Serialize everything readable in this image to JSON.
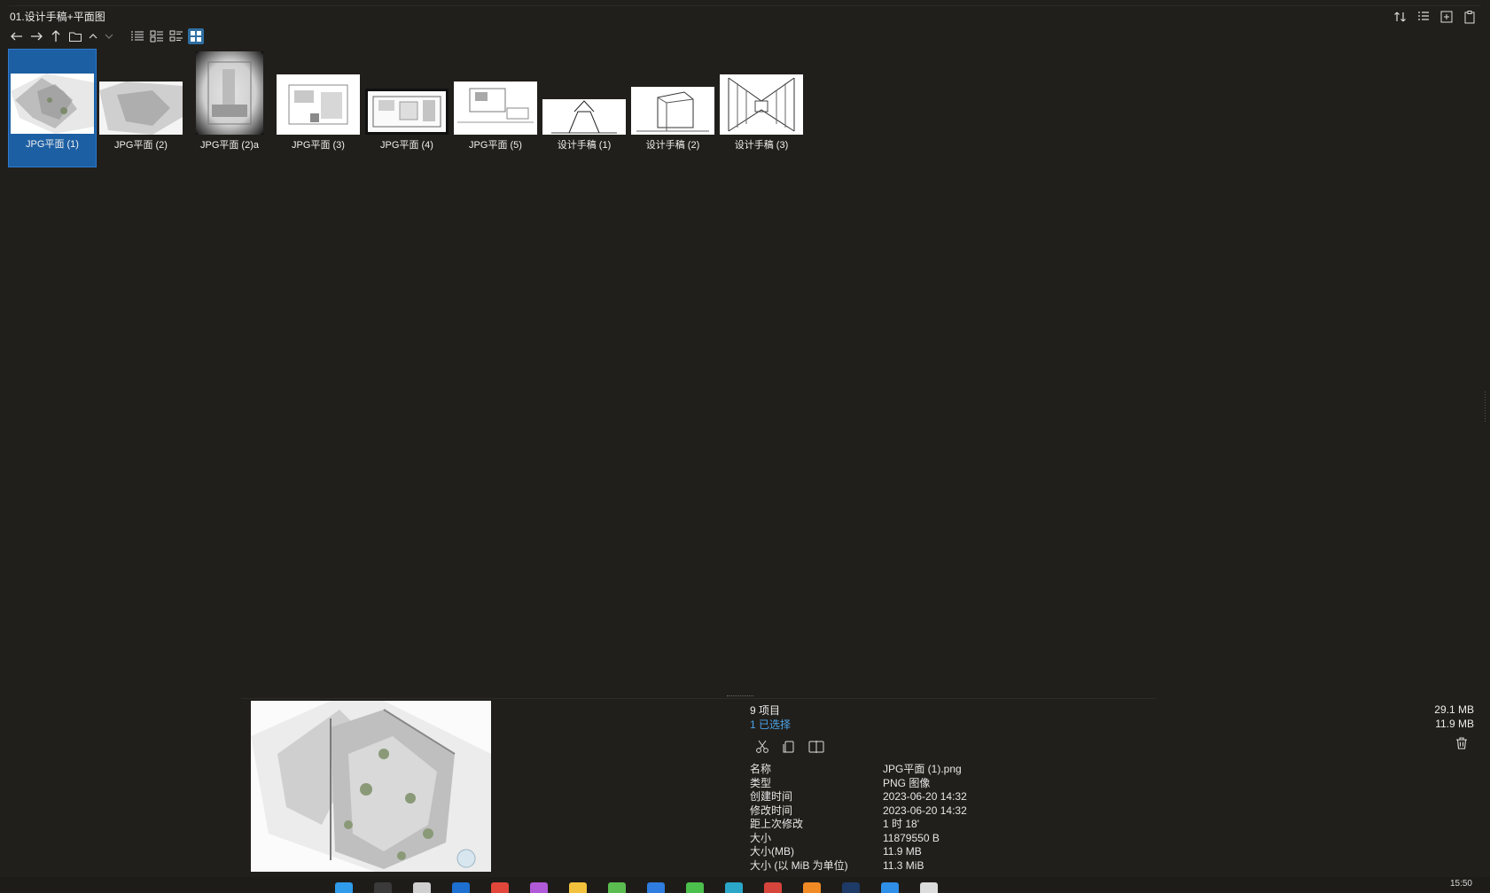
{
  "window": {
    "title": "01.设计手稿+平面图"
  },
  "toolbar": {
    "buttons": [
      {
        "name": "back-button",
        "icon": "arrow-left-icon"
      },
      {
        "name": "forward-button",
        "icon": "arrow-right-icon"
      },
      {
        "name": "up-button",
        "icon": "arrow-up-icon"
      },
      {
        "name": "folder-button",
        "icon": "folder-icon"
      },
      {
        "name": "chevron-up-button",
        "icon": "chevron-up-icon"
      },
      {
        "name": "chevron-down-button",
        "icon": "chevron-down-icon"
      },
      {
        "name": "view-list-button",
        "icon": "list-view-icon"
      },
      {
        "name": "view-details-button",
        "icon": "details-view-icon"
      },
      {
        "name": "view-tiles-button",
        "icon": "tiles-view-icon"
      },
      {
        "name": "view-thumbnails-button",
        "icon": "thumbnails-view-icon",
        "active": true
      }
    ],
    "active_color": "#2f6fa3"
  },
  "top_right": [
    "sort-icon",
    "properties-icon",
    "new-icon",
    "paste-icon"
  ],
  "files": [
    {
      "label": "JPG平面 (1)",
      "selected": true
    },
    {
      "label": "JPG平面 (2)"
    },
    {
      "label": "JPG平面 (2)a"
    },
    {
      "label": "JPG平面 (3)"
    },
    {
      "label": "JPG平面 (4)"
    },
    {
      "label": "JPG平面 (5)"
    },
    {
      "label": "设计手稿 (1)"
    },
    {
      "label": "设计手稿 (2)"
    },
    {
      "label": "设计手稿 (3)"
    }
  ],
  "status": {
    "item_count": "9 项目",
    "selected_count": "1 已选择",
    "total_size": "29.1 MB",
    "selected_size": "11.9 MB"
  },
  "properties": [
    {
      "key": "名称",
      "value": "JPG平面 (1).png"
    },
    {
      "key": "类型",
      "value": "PNG 图像"
    },
    {
      "key": "创建时间",
      "value": "2023-06-20  14:32"
    },
    {
      "key": "修改时间",
      "value": "2023-06-20  14:32"
    },
    {
      "key": "距上次修改",
      "value": "1 时 18'"
    },
    {
      "key": "大小",
      "value": "11879550 B"
    },
    {
      "key": "大小(MB)",
      "value": "11.9 MB"
    },
    {
      "key": "大小 (以 MiB 为单位)",
      "value": "11.3 MiB"
    }
  ],
  "taskbar": {
    "clock": "15:50",
    "icon_colors": [
      "#2f9bea",
      "#3a3a3a",
      "#cfcfcf",
      "#1d6fd0",
      "#e0463a",
      "#b05ad8",
      "#f3c23c",
      "#5bbd50",
      "#2f7de0",
      "#4cc04c",
      "#2aa7c9",
      "#d6453b",
      "#f08a24",
      "#1e3a66",
      "#2f8ee8",
      "#dcdcdc"
    ]
  },
  "colors": {
    "background": "#211f1b",
    "selection": "#1d5fa3",
    "link": "#4aa3e8"
  }
}
